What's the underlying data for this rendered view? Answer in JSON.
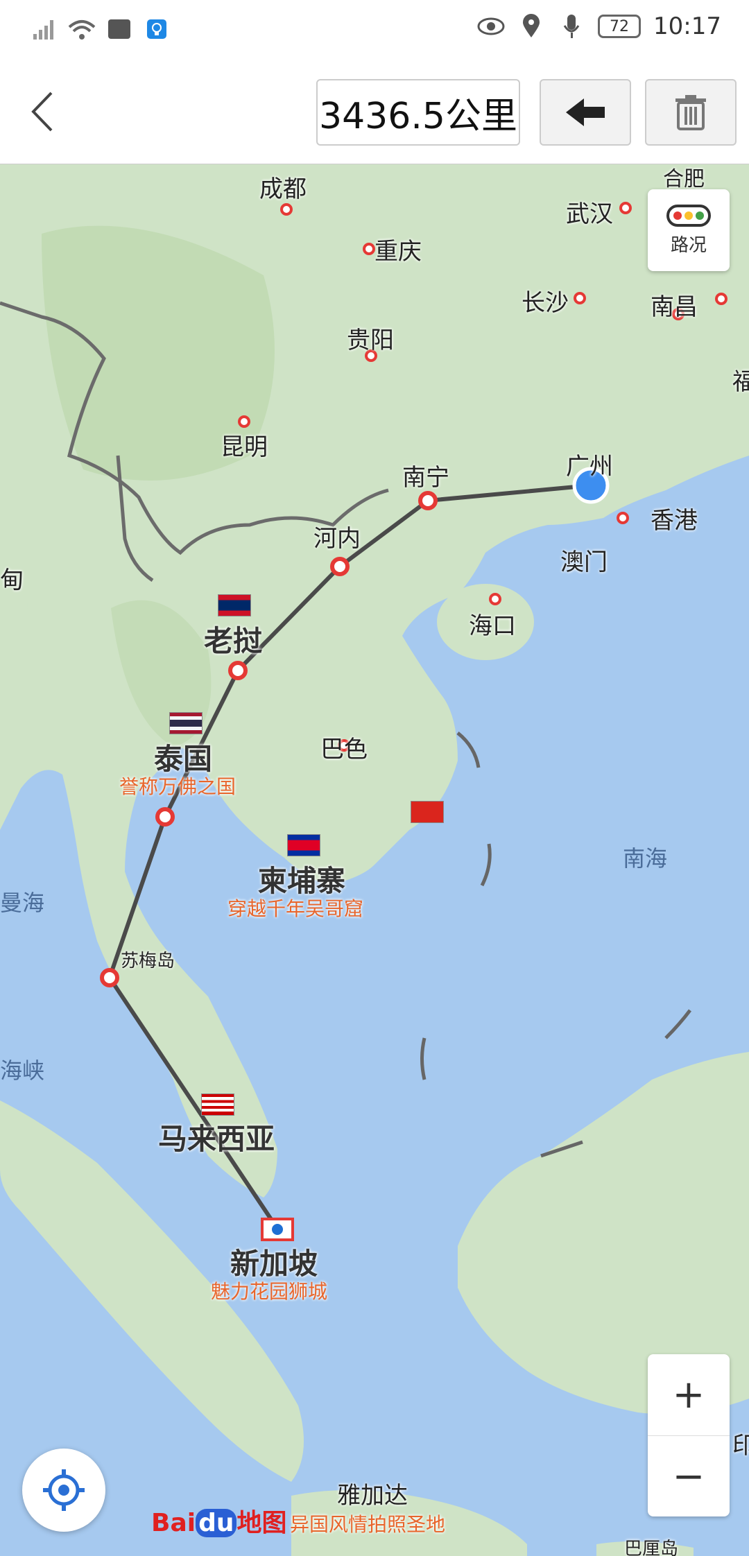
{
  "status": {
    "time": "10:17",
    "battery": "72",
    "icons": [
      "no-signal-icon",
      "wifi-icon",
      "huawei-icon",
      "bulb-icon",
      "eye-icon",
      "location-icon",
      "mic-icon"
    ]
  },
  "toolbar": {
    "distance": "3436.5公里",
    "back_icon": "chevron-left-icon",
    "undo_icon": "arrow-left-icon",
    "clear_icon": "trash-icon"
  },
  "map": {
    "cities": {
      "chengdu": "成都",
      "chongqing": "重庆",
      "wuhan": "武汉",
      "changsha": "长沙",
      "nanchang": "南昌",
      "guiyang": "贵阳",
      "kunming": "昆明",
      "nanning": "南宁",
      "guangzhou": "广州",
      "hongkong": "香港",
      "macau": "澳门",
      "hanoi": "河内",
      "haikou": "海口",
      "laos": "老挝",
      "pakse": "巴色",
      "thailand": "泰国",
      "thailand_tag": "誉称万佛之国",
      "cambodia": "柬埔寨",
      "cambodia_tag": "穿越千年吴哥窟",
      "sumei": "苏梅岛",
      "malaysia": "马来西亚",
      "singapore": "新加坡",
      "singapore_tag": "魅力花园狮城",
      "jakarta": "雅加达",
      "jakarta_tag": "异国风情拍照圣地",
      "myanmar": "甸",
      "fujian": "福",
      "hefei": "合肥",
      "indonesia": "印",
      "bali": "巴厘岛"
    },
    "seas": {
      "south_china_sea": "南海",
      "andaman": "曼海",
      "strait": "海峡"
    },
    "traffic_label": "路况",
    "zoom_in": "+",
    "zoom_out": "−",
    "logo_bai": "Bai",
    "logo_du": "du",
    "logo_map": "地图",
    "colors": {
      "route": "#4a4a4a",
      "waypoint": "#e53935",
      "water": "#a6c9ef",
      "land": "#cfe3c6",
      "tag": "#e8652b"
    }
  }
}
